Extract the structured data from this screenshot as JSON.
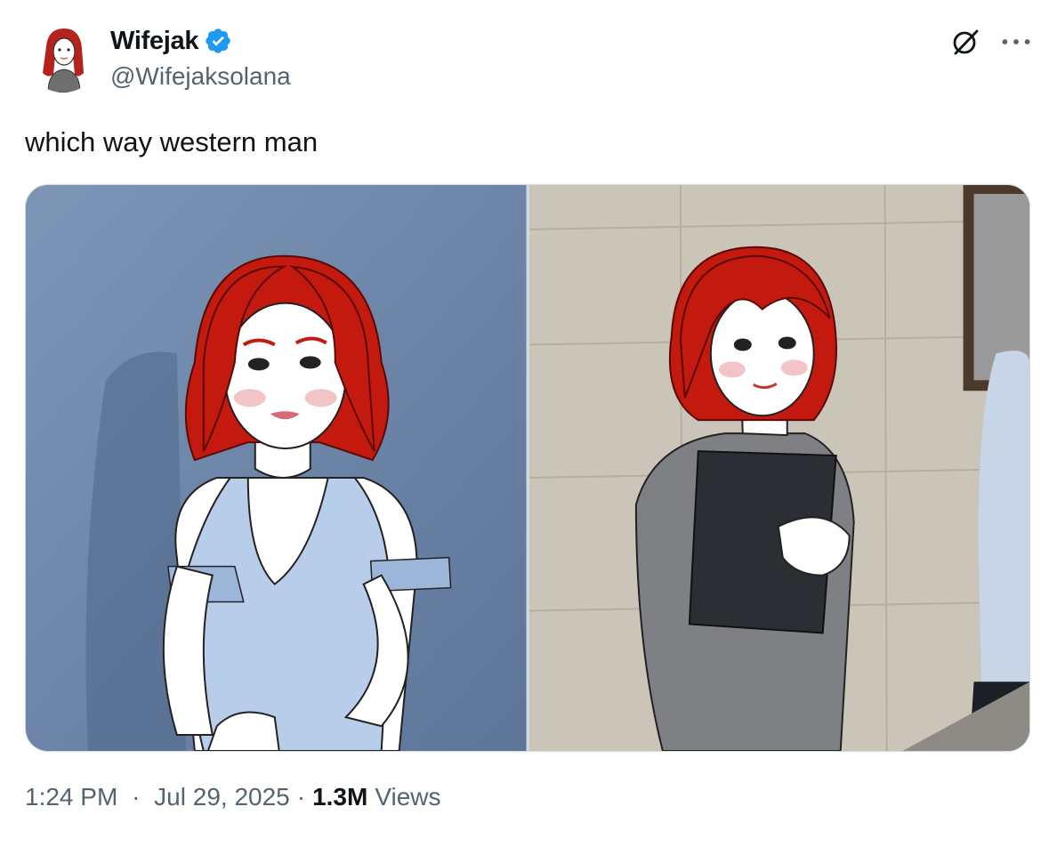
{
  "author": {
    "display_name": "Wifejak",
    "handle": "@Wifejaksolana",
    "verified": true,
    "avatar_icon": "avatar-illustration",
    "verified_color": "#1d9bf0"
  },
  "tweet": {
    "text": "which way western man",
    "time": "1:24 PM",
    "separator": "·",
    "date": "Jul 29, 2025",
    "views_count": "1.3M",
    "views_label": "Views"
  },
  "actions": {
    "grok_icon": "grok-icon",
    "more_icon": "more-dots-icon"
  },
  "media": [
    {
      "icon": "image-left-illustration"
    },
    {
      "icon": "image-right-illustration"
    }
  ],
  "colors": {
    "text_primary": "#0f1419",
    "text_secondary": "#536471",
    "border": "#cfd9de",
    "hair_red": "#c3190f",
    "left_bg": "#6c86a8",
    "right_bg": "#c9c2b6"
  }
}
